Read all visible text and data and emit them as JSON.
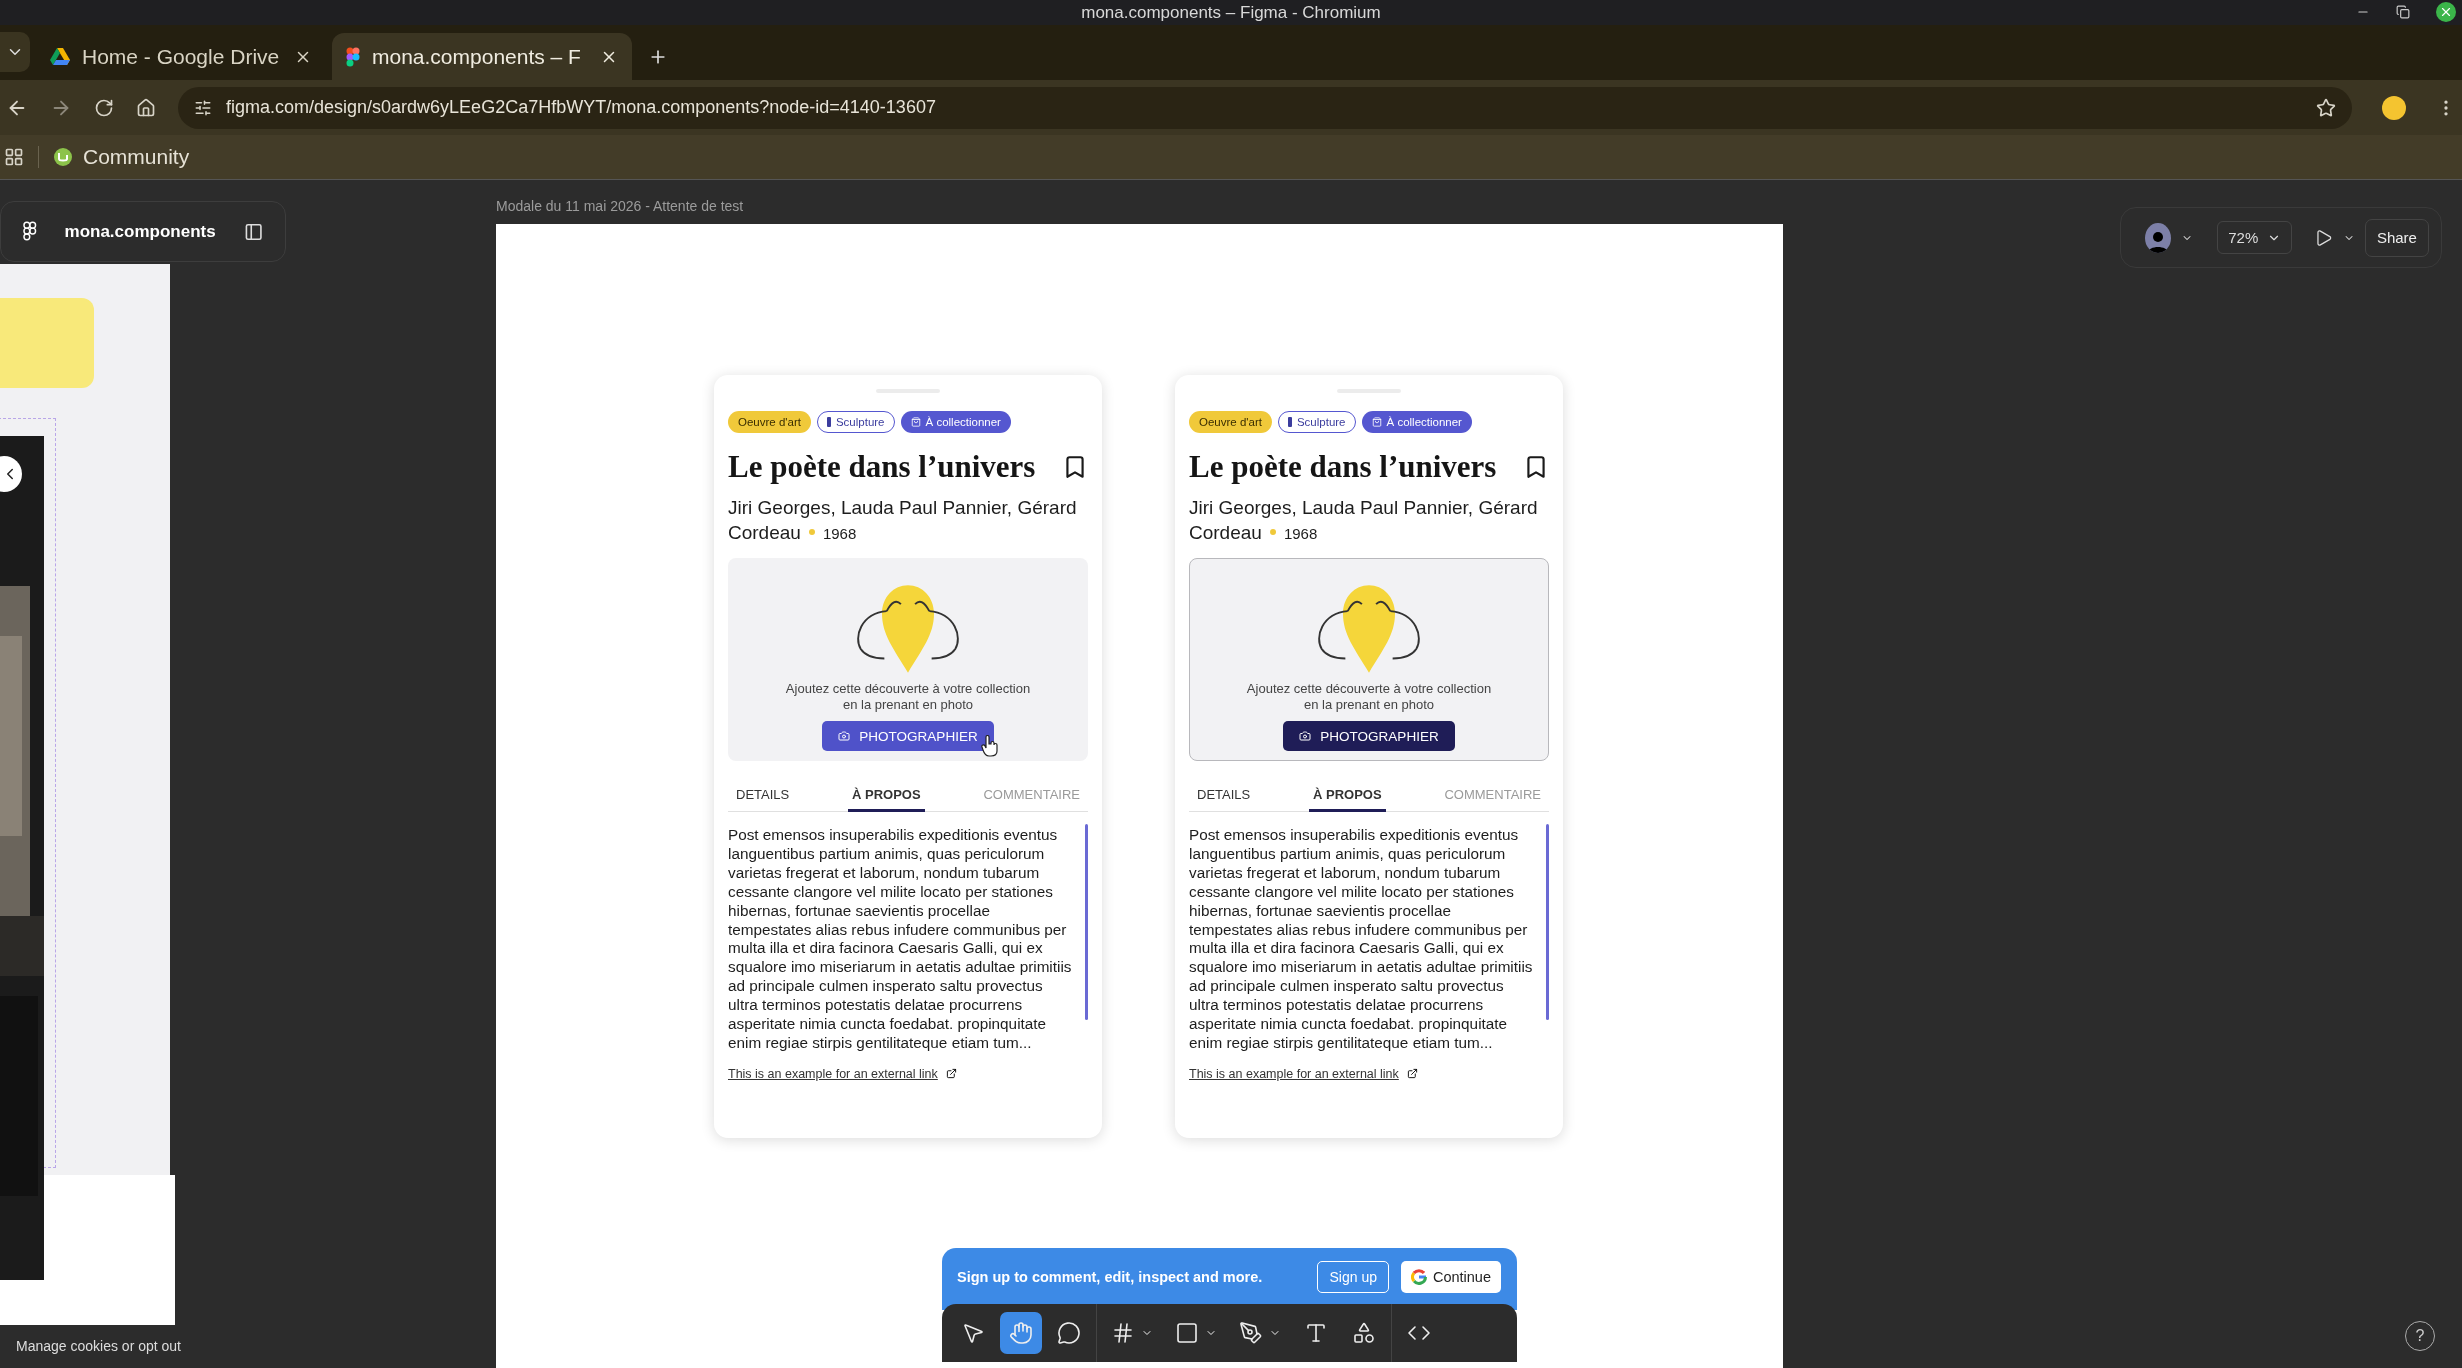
{
  "window": {
    "title": "mona.components – Figma - Chromium"
  },
  "browser": {
    "tabs": [
      {
        "title": "Home - Google Drive",
        "selected": false
      },
      {
        "title": "mona.components – F",
        "selected": true
      }
    ],
    "url": "figma.com/design/s0ardw6yLEeG2Ca7HfbWYT/mona.components?node-id=4140-13607",
    "bookmarks": [
      {
        "label": "Community"
      }
    ]
  },
  "figma": {
    "file_name": "mona.components",
    "frame_label": "Modale du 11 mai 2026 - Attente de test",
    "zoom": "72%",
    "share": "Share",
    "tools": [
      {
        "kind": "move",
        "selected": false,
        "menu": false
      },
      {
        "kind": "hand",
        "selected": true,
        "menu": false
      },
      {
        "kind": "comment",
        "selected": false,
        "menu": false
      },
      {
        "kind": "frame",
        "selected": false,
        "menu": true
      },
      {
        "kind": "shape",
        "selected": false,
        "menu": true
      },
      {
        "kind": "pen",
        "selected": false,
        "menu": true
      },
      {
        "kind": "text",
        "selected": false,
        "menu": false
      },
      {
        "kind": "assets",
        "selected": false,
        "menu": false
      },
      {
        "kind": "code",
        "selected": false,
        "menu": false
      }
    ],
    "signup": {
      "message": "Sign up to comment, edit, inspect and more.",
      "sign_up": "Sign up",
      "continue": "Continue"
    },
    "cookies": "Manage cookies or opt out",
    "help": "?"
  },
  "cards": [
    {
      "chips": [
        {
          "label": "Oeuvre d'art",
          "kind": "category"
        },
        {
          "label": "Sculpture",
          "kind": "outline"
        },
        {
          "label": "À collectionner",
          "kind": "filled"
        }
      ],
      "title": "Le poète dans l’univers",
      "authors": "Jiri Georges, Lauda Paul Pannier, Gérard Cordeau",
      "year": "1968",
      "prompt": "Ajoutez cette découverte à votre collection en la prenant en photo",
      "button": "PHOTOGRAPHIER",
      "hovered": true,
      "tabs": [
        {
          "label": "DETAILS",
          "selected": false,
          "disabled": false
        },
        {
          "label": "À PROPOS",
          "selected": true,
          "disabled": false
        },
        {
          "label": "COMMENTAIRE",
          "selected": false,
          "disabled": true
        }
      ],
      "body": "Post emensos insuperabilis expeditionis eventus languentibus partium animis, quas periculorum varietas fregerat et laborum, nondum tubarum cessante clangore vel milite locato per stationes hibernas, fortunae saevientis procellae tempestates alias rebus infudere communibus per multa illa et dira facinora Caesaris Galli, qui ex squalore imo miseriarum in aetatis adultae primitiis ad principale culmen insperato saltu provectus ultra terminos potestatis delatae procurrens asperitate nimia cuncta foedabat. propinquitate enim regiae stirpis gentilitateque etiam tum...",
      "link": "This is an example for an external link"
    },
    {
      "chips": [
        {
          "label": "Oeuvre d'art",
          "kind": "category"
        },
        {
          "label": "Sculpture",
          "kind": "outline"
        },
        {
          "label": "À collectionner",
          "kind": "filled"
        }
      ],
      "title": "Le poète dans l’univers",
      "authors": "Jiri Georges, Lauda Paul Pannier, Gérard Cordeau",
      "year": "1968",
      "prompt": "Ajoutez cette découverte à votre collection en la prenant en photo",
      "button": "PHOTOGRAPHIER",
      "hovered": false,
      "tabs": [
        {
          "label": "DETAILS",
          "selected": false,
          "disabled": false
        },
        {
          "label": "À PROPOS",
          "selected": true,
          "disabled": false
        },
        {
          "label": "COMMENTAIRE",
          "selected": false,
          "disabled": true
        }
      ],
      "body": "Post emensos insuperabilis expeditionis eventus languentibus partium animis, quas periculorum varietas fregerat et laborum, nondum tubarum cessante clangore vel milite locato per stationes hibernas, fortunae saevientis procellae tempestates alias rebus infudere communibus per multa illa et dira facinora Caesaris Galli, qui ex squalore imo miseriarum in aetatis adultae primitiis ad principale culmen insperato saltu provectus ultra terminos potestatis delatae procurrens asperitate nimia cuncta foedabat. propinquitate enim regiae stirpis gentilitateque etiam tum...",
      "link": "This is an example for an external link"
    }
  ]
}
